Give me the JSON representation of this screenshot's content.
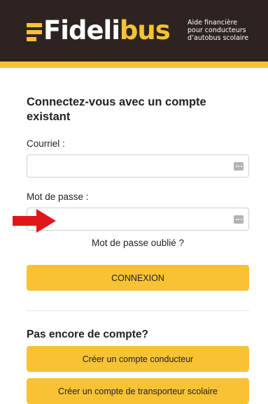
{
  "header": {
    "logo_text_white": "Fideli",
    "logo_text_yellow": "bus",
    "tagline": [
      "Aide financière",
      "pour conducteurs",
      "d’autobus scolaire"
    ],
    "colors": {
      "background": "#2d2422",
      "accent": "#f7c233"
    }
  },
  "login": {
    "title": "Connectez-vous avec un compte existant",
    "email_label": "Courriel :",
    "email_value": "",
    "password_label": "Mot de passe :",
    "password_value": "",
    "password_manager_icon": "password-dots-icon",
    "forgot_link": "Mot de passe oublié ?",
    "submit_label": "CONNEXION"
  },
  "annotation": {
    "arrow_icon": "red-arrow-right-icon",
    "color": "#e1161b"
  },
  "signup": {
    "title": "Pas encore de compte?",
    "driver_button": "Créer un compte conducteur",
    "carrier_button": "Créer un compte de transporteur scolaire"
  },
  "colors": {
    "button": "#f7c233",
    "text": "#222222"
  }
}
